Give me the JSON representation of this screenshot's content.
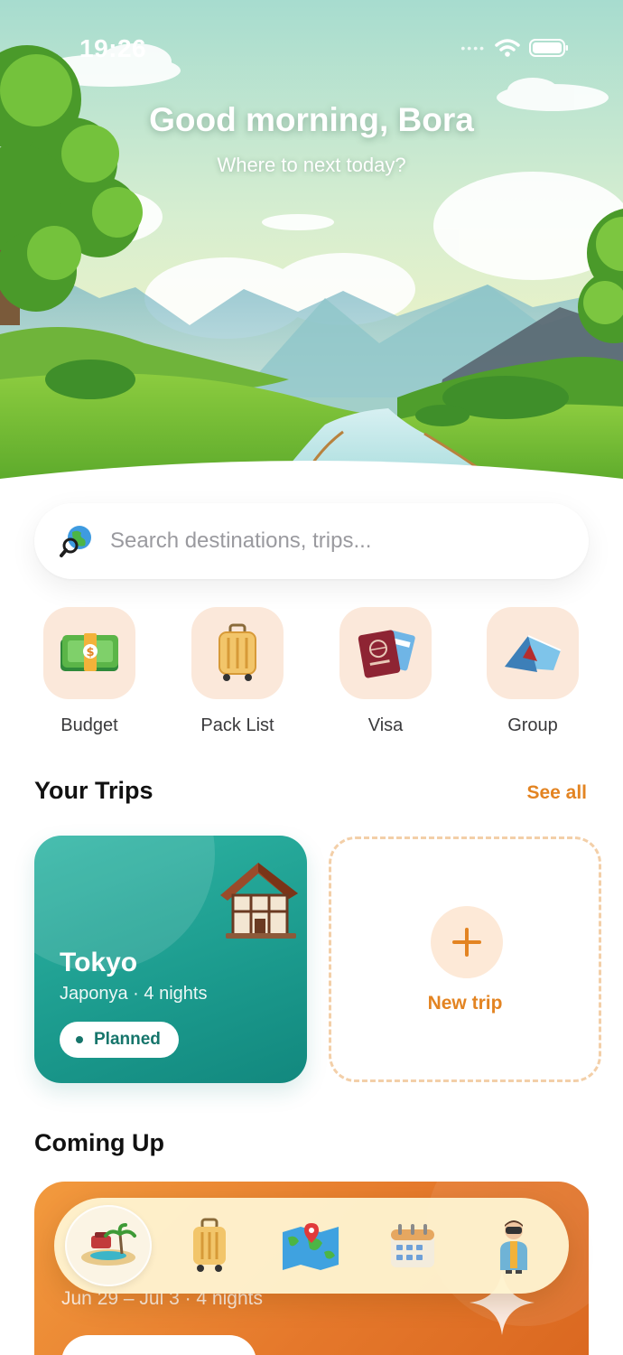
{
  "status_bar": {
    "time": "19:26"
  },
  "hero": {
    "greeting": "Good morning, Bora",
    "subtitle": "Where to next today?"
  },
  "search": {
    "placeholder": "Search destinations, trips...",
    "icon": "globe-search-icon"
  },
  "quick_actions": [
    {
      "label": "Budget",
      "icon": "money-stack-icon"
    },
    {
      "label": "Pack List",
      "icon": "suitcase-icon"
    },
    {
      "label": "Visa",
      "icon": "passport-icon"
    },
    {
      "label": "Group",
      "icon": "tent-icon"
    }
  ],
  "your_trips": {
    "title": "Your Trips",
    "see_all": "See all",
    "trips": [
      {
        "city": "Tokyo",
        "meta": "Japonya · 4 nights",
        "status": "Planned",
        "icon": "house-icon",
        "color": "#1b9a8d"
      }
    ],
    "new_trip_label": "New trip"
  },
  "coming_up": {
    "title": "Coming Up",
    "dates": "Jun 29 – Jul 3 · 4 nights",
    "color": "#e5782b"
  },
  "bottom_nav": [
    {
      "name": "home",
      "icon": "island-icon",
      "active": true
    },
    {
      "name": "pack",
      "icon": "suitcase-icon",
      "active": false
    },
    {
      "name": "map",
      "icon": "map-icon",
      "active": false
    },
    {
      "name": "calendar",
      "icon": "calendar-icon",
      "active": false
    },
    {
      "name": "profile",
      "icon": "traveler-icon",
      "active": false
    }
  ],
  "colors": {
    "accent": "#e38422",
    "teal": "#1b9a8d",
    "tile": "#fbe8da"
  }
}
